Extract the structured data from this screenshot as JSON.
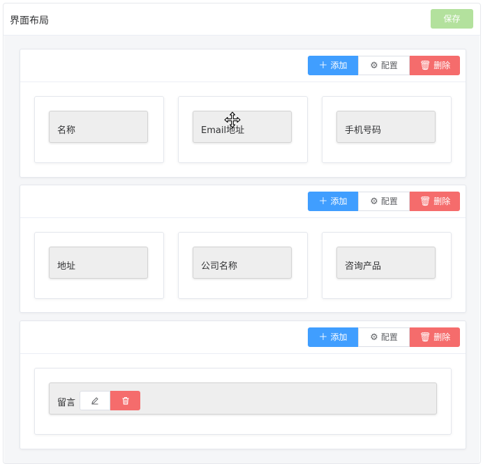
{
  "header": {
    "title": "界面布局",
    "save_label": "保存"
  },
  "row_toolbar": {
    "add_label": "添加",
    "config_label": "配置",
    "delete_label": "删除"
  },
  "rows": [
    {
      "fields": [
        "名称",
        "Email地址",
        "手机号码"
      ]
    },
    {
      "fields": [
        "地址",
        "公司名称",
        "咨询产品"
      ]
    },
    {
      "fields": [
        "留言"
      ]
    }
  ],
  "icons": {
    "add": "plus-icon",
    "config": "gear-icon",
    "delete": "trash-icon",
    "edit": "pencil-icon",
    "move_cursor": "move-cursor-icon"
  },
  "colors": {
    "primary": "#409eff",
    "danger": "#f56c6c",
    "success_light": "#b3e19d",
    "field_bg": "#eeeeee",
    "page_bg": "#f5f6f8"
  }
}
